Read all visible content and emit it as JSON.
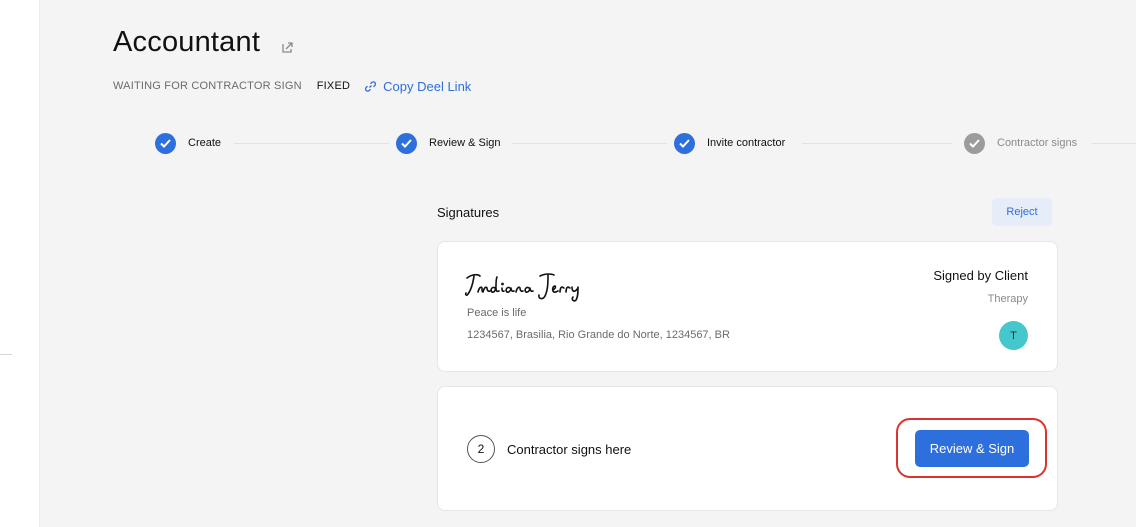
{
  "header": {
    "title": "Accountant",
    "status": "WAITING FOR CONTRACTOR SIGN",
    "contract_type": "FIXED",
    "copy_link_label": "Copy Deel Link"
  },
  "stepper": {
    "steps": [
      {
        "label": "Create",
        "state": "done"
      },
      {
        "label": "Review & Sign",
        "state": "done"
      },
      {
        "label": "Invite contractor",
        "state": "done"
      },
      {
        "label": "Contractor signs",
        "state": "pending"
      }
    ]
  },
  "signatures": {
    "heading": "Signatures",
    "reject_label": "Reject",
    "client": {
      "signature_text": "Indiana Jerry",
      "job_title": "Peace is life",
      "address": "1234567, Brasilia, Rio Grande do Norte, 1234567, BR",
      "signed_label": "Signed by Client",
      "company": "Therapy",
      "avatar_initial": "T"
    },
    "contractor": {
      "step_number": "2",
      "prompt": "Contractor signs here",
      "button_label": "Review & Sign"
    }
  },
  "colors": {
    "primary": "#2d6fdc",
    "link": "#2f6fd8",
    "avatar": "#45c7cc",
    "highlight": "#d9342f",
    "pending": "#9c9c9c"
  },
  "icons": {
    "edit": "external-edit-icon",
    "link": "link-icon",
    "step_done": "check-circle-icon"
  }
}
